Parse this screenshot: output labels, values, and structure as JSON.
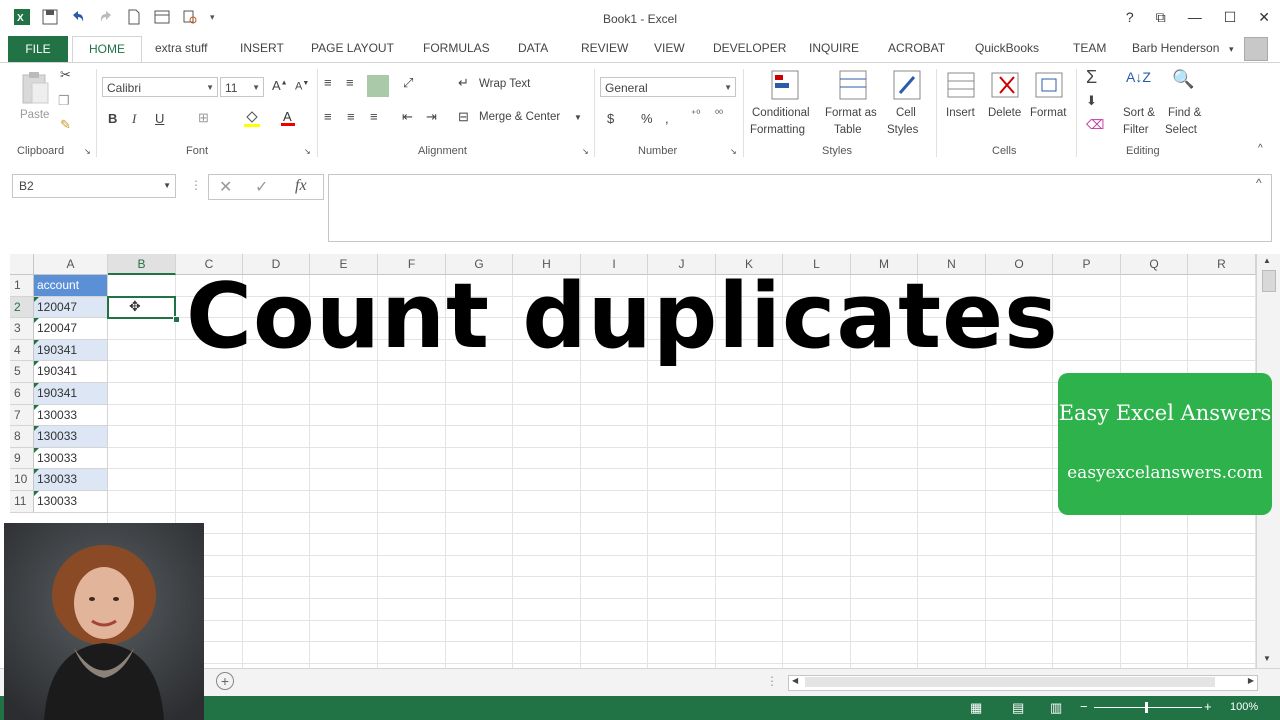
{
  "window": {
    "title": "Book1 - Excel"
  },
  "ribbon": {
    "tabs": [
      "FILE",
      "HOME",
      "extra stuff",
      "INSERT",
      "PAGE LAYOUT",
      "FORMULAS",
      "DATA",
      "REVIEW",
      "VIEW",
      "DEVELOPER",
      "INQUIRE",
      "ACROBAT",
      "QuickBooks",
      "TEAM"
    ],
    "user": "Barb Henderson",
    "clipboard": {
      "paste": "Paste",
      "label": "Clipboard"
    },
    "font": {
      "name": "Calibri",
      "size": "11",
      "label": "Font"
    },
    "alignment": {
      "wrap": "Wrap Text",
      "merge": "Merge & Center",
      "label": "Alignment"
    },
    "number": {
      "format": "General",
      "label": "Number"
    },
    "styles": {
      "conditional": [
        "Conditional",
        "Formatting"
      ],
      "table": [
        "Format as",
        "Table"
      ],
      "cell": [
        "Cell",
        "Styles"
      ],
      "label": "Styles"
    },
    "cells": {
      "insert": "Insert",
      "delete": "Delete",
      "format": "Format",
      "label": "Cells"
    },
    "editing": {
      "sort": [
        "Sort &",
        "Filter"
      ],
      "find": [
        "Find &",
        "Select"
      ],
      "label": "Editing"
    }
  },
  "formula_bar": {
    "name_box": "B2",
    "formula": ""
  },
  "grid": {
    "columns": [
      "A",
      "B",
      "C",
      "D",
      "E",
      "F",
      "G",
      "H",
      "I",
      "J",
      "K",
      "L",
      "M",
      "N",
      "O",
      "P",
      "Q",
      "R"
    ],
    "rows": [
      "1",
      "2",
      "3",
      "4",
      "5",
      "6",
      "7",
      "8",
      "9",
      "10",
      "11"
    ],
    "col_a_values": [
      "account",
      "120047",
      "120047",
      "190341",
      "190341",
      "190341",
      "130033",
      "130033",
      "130033",
      "130033",
      "130033"
    ],
    "selected_cell": "B2"
  },
  "overlay": {
    "title": "Count duplicates",
    "badge_title": "Easy Excel Answers",
    "badge_url": "easyexcelanswers.com"
  },
  "status": {
    "zoom": "100%"
  },
  "colors": {
    "excel_green": "#217346",
    "badge_green": "#2eb24b",
    "highlight": "#dce6f4"
  }
}
